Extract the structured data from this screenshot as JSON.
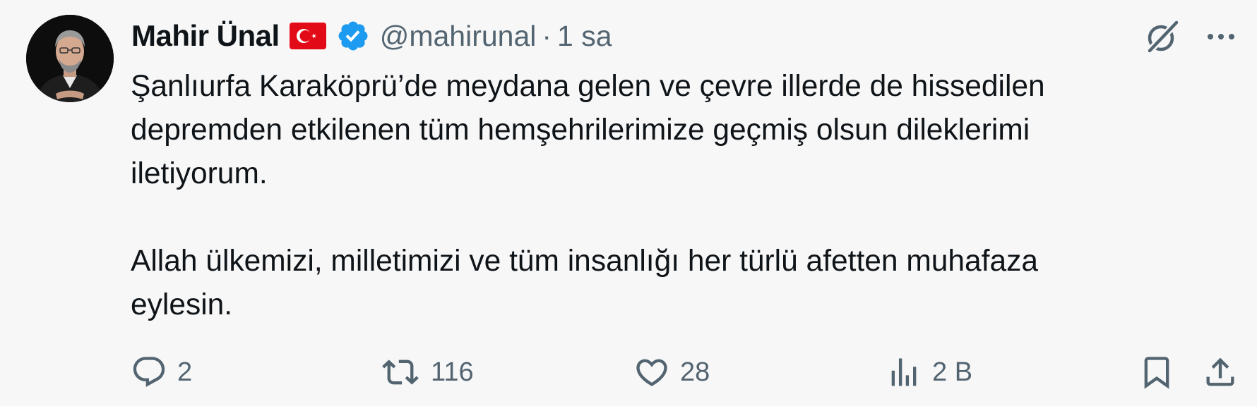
{
  "tweet": {
    "author": {
      "name": "Mahir Ünal",
      "handle": "@mahirunal",
      "avatar_icon": "profile-photo",
      "flag_icon": "turkey-flag",
      "verified_icon": "verified-badge",
      "verified_color": "#1d9bf0"
    },
    "separator": "·",
    "time": "1 sa",
    "paragraphs": [
      "Şanlıurfa Karaköprü’de meydana gelen ve çevre illerde de hissedilen depremden etkilenen tüm hemşehrilerimize geçmiş olsun dileklerimi iletiyorum.",
      "Allah ülkemizi, milletimizi ve tüm insanlığı her türlü afetten muhafaza eylesin."
    ],
    "actions": {
      "replies": "2",
      "reposts": "116",
      "likes": "28",
      "views": "2 B"
    }
  },
  "colors": {
    "background": "#f7f7f7",
    "text": "#0f1419",
    "muted": "#536471",
    "flag_red": "#e30a17"
  }
}
